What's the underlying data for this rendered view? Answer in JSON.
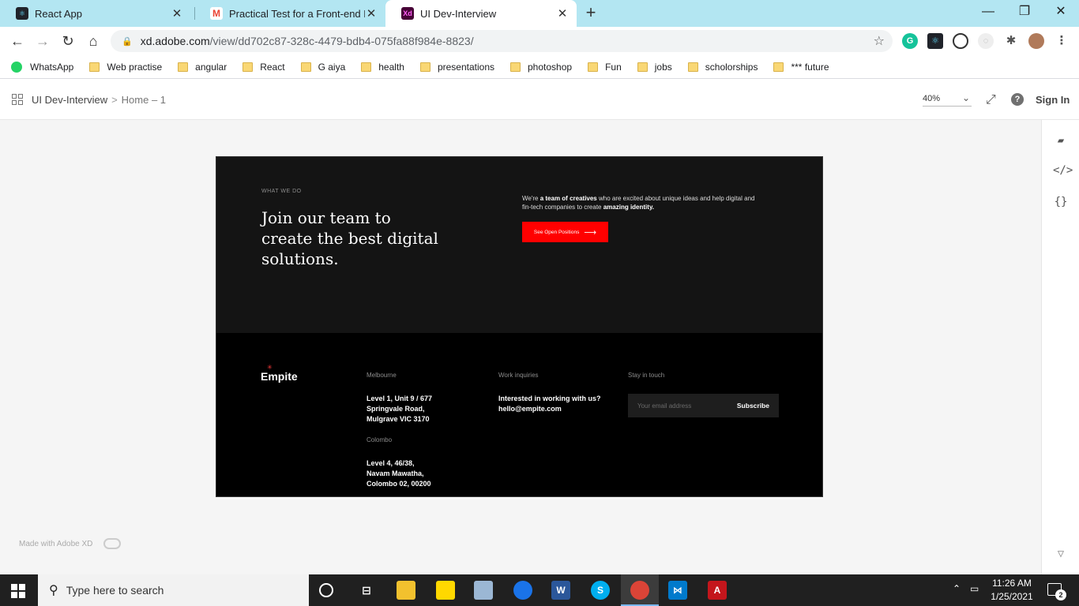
{
  "browser": {
    "tabs": [
      {
        "title": "React App",
        "icon": "react-icon"
      },
      {
        "title": "Practical Test for a Front-end Dev",
        "icon": "gmail-icon"
      },
      {
        "title": "UI Dev-Interview",
        "icon": "adobe-xd-icon",
        "active": true
      }
    ],
    "url_domain": "xd.adobe.com",
    "url_path": "/view/dd702c87-328c-4479-bdb4-075fa88f984e-8823/",
    "bookmarks": [
      "WhatsApp",
      "Web practise",
      "angular",
      "React",
      "G aiya",
      "health",
      "presentations",
      "photoshop",
      "Fun",
      "jobs",
      "scholorships",
      "*** future"
    ]
  },
  "xd_header": {
    "project": "UI Dev-Interview",
    "separator": ">",
    "page": "Home – 1",
    "zoom": "40%",
    "sign_in": "Sign In"
  },
  "artboard": {
    "eyebrow": "WHAT WE DO",
    "title": "Join our team to create the best digital solutions.",
    "desc_1": "We're ",
    "desc_bold_1": "a team of creatives",
    "desc_2": " who are excited about unique ideas and help digital and fin-tech companies to create ",
    "desc_bold_2": "amazing identity.",
    "cta": "See Open Positions",
    "logo": "Empite",
    "melbourne_label": "Melbourne",
    "melbourne_addr": [
      "Level 1, Unit 9 / 677",
      "Springvale Road,",
      "Mulgrave VIC 3170"
    ],
    "colombo_label": "Colombo",
    "colombo_addr": [
      "Level 4, 46/38,",
      "Navam Mawatha,",
      "Colombo 02, 00200"
    ],
    "work_label": "Work inquiries",
    "work_text": "Interested in working with us?",
    "work_email": "hello@empite.com",
    "touch_label": "Stay in touch",
    "email_placeholder": "Your email address",
    "subscribe": "Subscribe"
  },
  "made_with": "Made with Adobe XD",
  "taskbar": {
    "search_placeholder": "Type here to search",
    "time": "11:26 AM",
    "date": "1/25/2021",
    "notifications": "2"
  },
  "colors": {
    "tab_strip": "#b3e6f2",
    "cta_red": "#ff0000",
    "hero_bg": "#141414",
    "footer_bg": "#000000"
  }
}
